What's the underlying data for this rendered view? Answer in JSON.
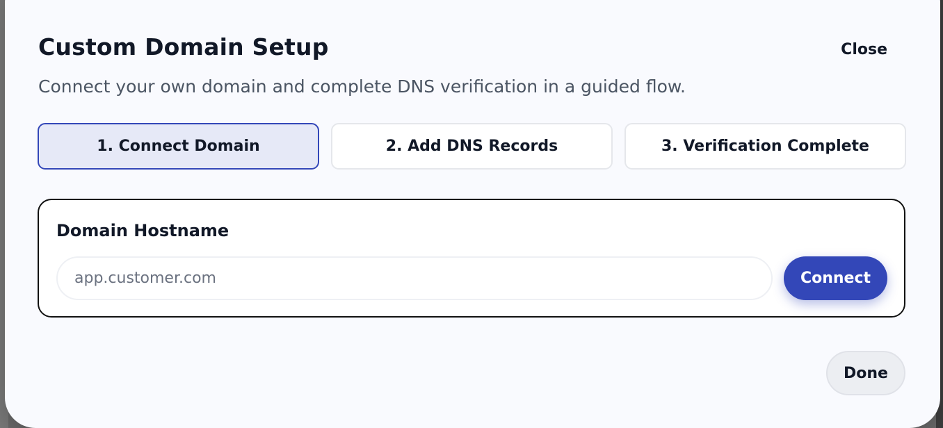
{
  "modal": {
    "title": "Custom Domain Setup",
    "close_label": "Close",
    "subtitle": "Connect your own domain and complete DNS verification in a guided flow."
  },
  "steps": [
    {
      "label": "1. Connect Domain",
      "active": true
    },
    {
      "label": "2. Add DNS Records",
      "active": false
    },
    {
      "label": "3. Verification Complete",
      "active": false
    }
  ],
  "domain_form": {
    "label": "Domain Hostname",
    "placeholder": "app.customer.com",
    "value": "",
    "connect_label": "Connect"
  },
  "footer": {
    "done_label": "Done"
  },
  "colors": {
    "accent": "#3347b8",
    "active_step_bg": "#e6e9f7",
    "modal_bg": "#f9fafe"
  }
}
